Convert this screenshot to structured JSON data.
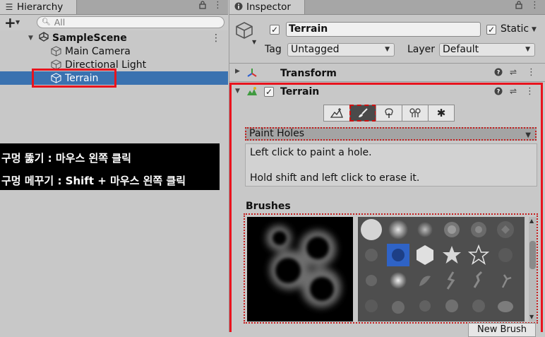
{
  "hierarchy": {
    "tab_label": "Hierarchy",
    "search_placeholder": "All",
    "scene_name": "SampleScene",
    "items": [
      {
        "label": "Main Camera"
      },
      {
        "label": "Directional Light"
      },
      {
        "label": "Terrain"
      }
    ]
  },
  "overlay": {
    "line1": "구멍 뚫기 : 마우스 왼쪽 클릭",
    "line2": "구멍 메꾸기 : Shift + 마우스 왼쪽 클릭"
  },
  "inspector": {
    "tab_label": "Inspector",
    "object_name": "Terrain",
    "static_label": "Static",
    "tag_label": "Tag",
    "tag_value": "Untagged",
    "layer_label": "Layer",
    "layer_value": "Default",
    "transform_title": "Transform",
    "terrain_title": "Terrain",
    "tool_mode": "Paint Holes",
    "help_line1": "Left click to paint a hole.",
    "help_line2": "Hold shift and left click to erase it.",
    "brushes_label": "Brushes",
    "new_brush_label": "New Brush"
  },
  "colors": {
    "highlight_red": "#e8141e",
    "selection_blue": "#3a72b0",
    "panel_bg": "#c8c8c8"
  },
  "icons": [
    "lock-icon",
    "kebab-menu-icon",
    "cube-icon",
    "unity-logo-icon",
    "help-icon",
    "preset-icon",
    "terrain-icon",
    "raise-lower-icon",
    "paint-brush-icon",
    "paint-tree-icon",
    "paint-details-icon",
    "settings-gear-icon"
  ]
}
